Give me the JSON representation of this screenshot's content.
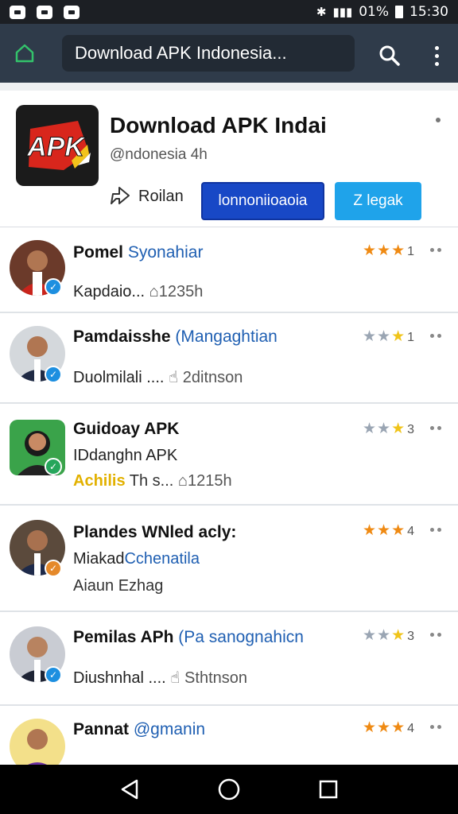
{
  "status_bar": {
    "icons_left": [
      "notification-icon",
      "app-icon",
      "image-icon"
    ],
    "battery": "01%",
    "time": "15:30"
  },
  "toolbar": {
    "search_text": "Download APK Indonesia...",
    "icons": [
      "home-icon",
      "search-icon",
      "more-vert-icon"
    ]
  },
  "app_header": {
    "logo_text": "APK",
    "title": "Download APK Indai",
    "subtitle": "@ndonesia 4h",
    "share_label": "Roilan",
    "primary_button": "lonnoniioaoia",
    "secondary_button": "Z legak",
    "colors": {
      "primary": "#1848c6",
      "secondary": "#1fa3ea"
    }
  },
  "list": [
    {
      "name": "Pomel",
      "accent_name": "Syonahiar",
      "line2_prefix": "Kapdaio...",
      "line2_meta": "1235h",
      "meta_icon": "home-icon",
      "rating_count": "1",
      "badge": "check",
      "badge_color": "#1d8fe0",
      "stars": [
        "#ef8a13",
        "#ef8a13",
        "#ef8a13"
      ]
    },
    {
      "name": "Pamdaisshe",
      "accent_name": "(Mangaghtian",
      "line2_prefix": "Duolmilali ....",
      "line2_meta": "2ditnson",
      "meta_icon": "hand-icon",
      "rating_count": "1",
      "badge": "check",
      "badge_color": "#1d8fe0",
      "stars": [
        "#9aa5b3",
        "#9aa5b3",
        "#f0c41a"
      ]
    },
    {
      "name": "Guidoay APK",
      "accent_name": "",
      "line2_prefix": "IDdanghn APK",
      "line3_yellow": "Achilis",
      "line3_prefix": "Th s...",
      "line3_meta": "1215h",
      "meta_icon": "home-icon",
      "rating_count": "3",
      "badge": "check",
      "badge_color": "#26a65b",
      "stars": [
        "#9aa5b3",
        "#9aa5b3",
        "#f0c41a"
      ]
    },
    {
      "name": "Plandes WNled acly:",
      "accent_name": "",
      "line2_prefix": "Miakad",
      "line2_accent": "Cchenatila",
      "line3_prefix": "Aiaun Ezhag",
      "rating_count": "4",
      "badge": "check",
      "badge_color": "#e5892a",
      "stars": [
        "#ef8a13",
        "#ef8a13",
        "#ef8a13"
      ]
    },
    {
      "name": "Pemilas APh",
      "accent_name": "(Pa sanognahicn",
      "line2_prefix": "Diushnhal ....",
      "line2_meta": "Sthtnson",
      "meta_icon": "hand-icon",
      "rating_count": "3",
      "badge": "check",
      "badge_color": "#1d8fe0",
      "stars": [
        "#9aa5b3",
        "#9aa5b3",
        "#f0c41a"
      ]
    },
    {
      "name": "Pannat",
      "accent_name": "@gmanin",
      "rating_count": "4",
      "badge": "check",
      "badge_color": "#1d8fe0",
      "stars": [
        "#ef8a13",
        "#ef8a13",
        "#ef8a13"
      ]
    }
  ],
  "nav_bar": {
    "icons": [
      "back-icon",
      "home-circle-icon",
      "recents-icon"
    ]
  }
}
